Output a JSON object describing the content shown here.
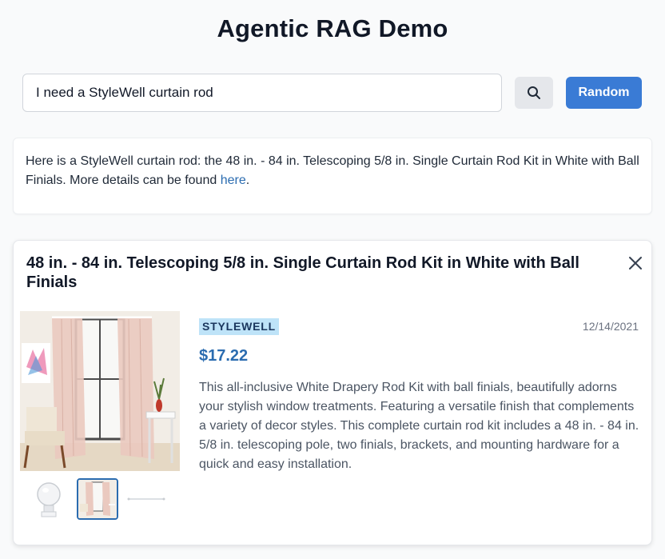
{
  "app": {
    "title": "Agentic RAG Demo"
  },
  "search": {
    "value": "I need a StyleWell curtain rod",
    "button_icon": "search-icon",
    "random_label": "Random"
  },
  "answer": {
    "text_before": "Here is a StyleWell curtain rod: the 48 in. - 84 in. Telescoping 5/8 in. Single Curtain Rod Kit in White with Ball Finials. More details can be found ",
    "link_text": "here",
    "text_after": "."
  },
  "product": {
    "title": "48 in. - 84 in. Telescoping 5/8 in. Single Curtain Rod Kit in White with Ball Finials",
    "brand": "STYLEWELL",
    "date": "12/14/2021",
    "price": "$17.22",
    "description": "This all-inclusive White Drapery Rod Kit with ball finials, beautifully adorns your stylish window treatments. Featuring a versatile finish that complements a variety of decor styles. This complete curtain rod kit includes a 48 in. - 84 in. 5/8 in. telescoping pole, two finials, brackets, and mounting hardware for a quick and easy installation.",
    "close_icon": "close-icon",
    "thumbnails": [
      "ball-finial",
      "curtain-room",
      "curtain-rod"
    ],
    "selected_thumbnail": 1
  },
  "colors": {
    "accent": "#3a7bd5",
    "link": "#2b6cb0",
    "brand_badge_bg": "#bee3f8"
  }
}
